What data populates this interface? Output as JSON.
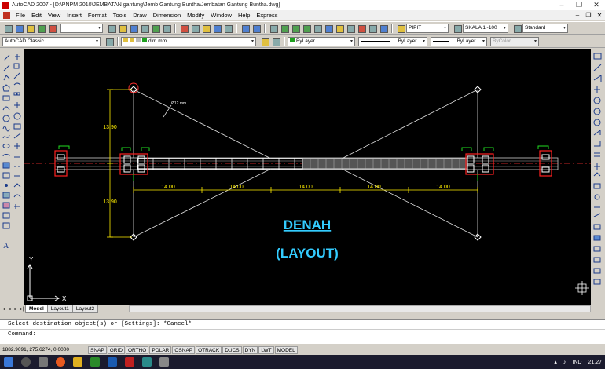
{
  "window": {
    "title": "AutoCAD 2007 - [D:\\PNPM 2010\\JEMBATAN gantung\\Jemb Gantung Buntha\\Jembatan Gantung Buntha.dwg]",
    "minimize": "–",
    "restore": "❐",
    "close": "✕"
  },
  "menu": {
    "items": [
      "File",
      "Edit",
      "View",
      "Insert",
      "Format",
      "Tools",
      "Draw",
      "Dimension",
      "Modify",
      "Window",
      "Help",
      "Express"
    ],
    "doc_minimize": "–",
    "doc_restore": "❐",
    "doc_close": "✕"
  },
  "toolbar": {
    "workspace": "AutoCAD Classic",
    "layer": "dim mm",
    "color": "ByLayer",
    "linetype": "ByLayer",
    "lineweight": "ByLayer",
    "plotstyle": "ByColor",
    "text_style": "PIPIT",
    "dim_style": "SKALA 1~100",
    "table_style": "Standard",
    "dropdown_arrow": "▾"
  },
  "drawing": {
    "title": "DENAH",
    "subtitle": "(LAYOUT)",
    "dimensions": [
      "14.00",
      "14.00",
      "14.00",
      "14.00",
      "14.00"
    ],
    "height_top": "13.90",
    "height_bottom": "13.90",
    "cable_label": "Ø12 mm",
    "ucs_x": "X",
    "ucs_y": "Y"
  },
  "tabs": {
    "nav": [
      "|◂",
      "◂",
      "▸",
      "▸|"
    ],
    "items": [
      "Model",
      "Layout1",
      "Layout2"
    ],
    "active": "Model"
  },
  "command": {
    "history": "Select destination object(s) or [Settings]: *Cancel*",
    "prompt": "Command:"
  },
  "status": {
    "coordinates": "1882.9091, 275.6274, 0.0000",
    "toggles": [
      "SNAP",
      "GRID",
      "ORTHO",
      "POLAR",
      "OSNAP",
      "OTRACK",
      "DUCS",
      "DYN",
      "LWT",
      "MODEL"
    ]
  },
  "taskbar": {
    "language": "IND",
    "time": "21.27"
  },
  "colors": {
    "canvas": "#000000",
    "title_text": "#33ccff",
    "dimension": "#ffee00",
    "cable": "#ffffff",
    "anchor": "#ff2020",
    "marker": "#20dd20"
  }
}
